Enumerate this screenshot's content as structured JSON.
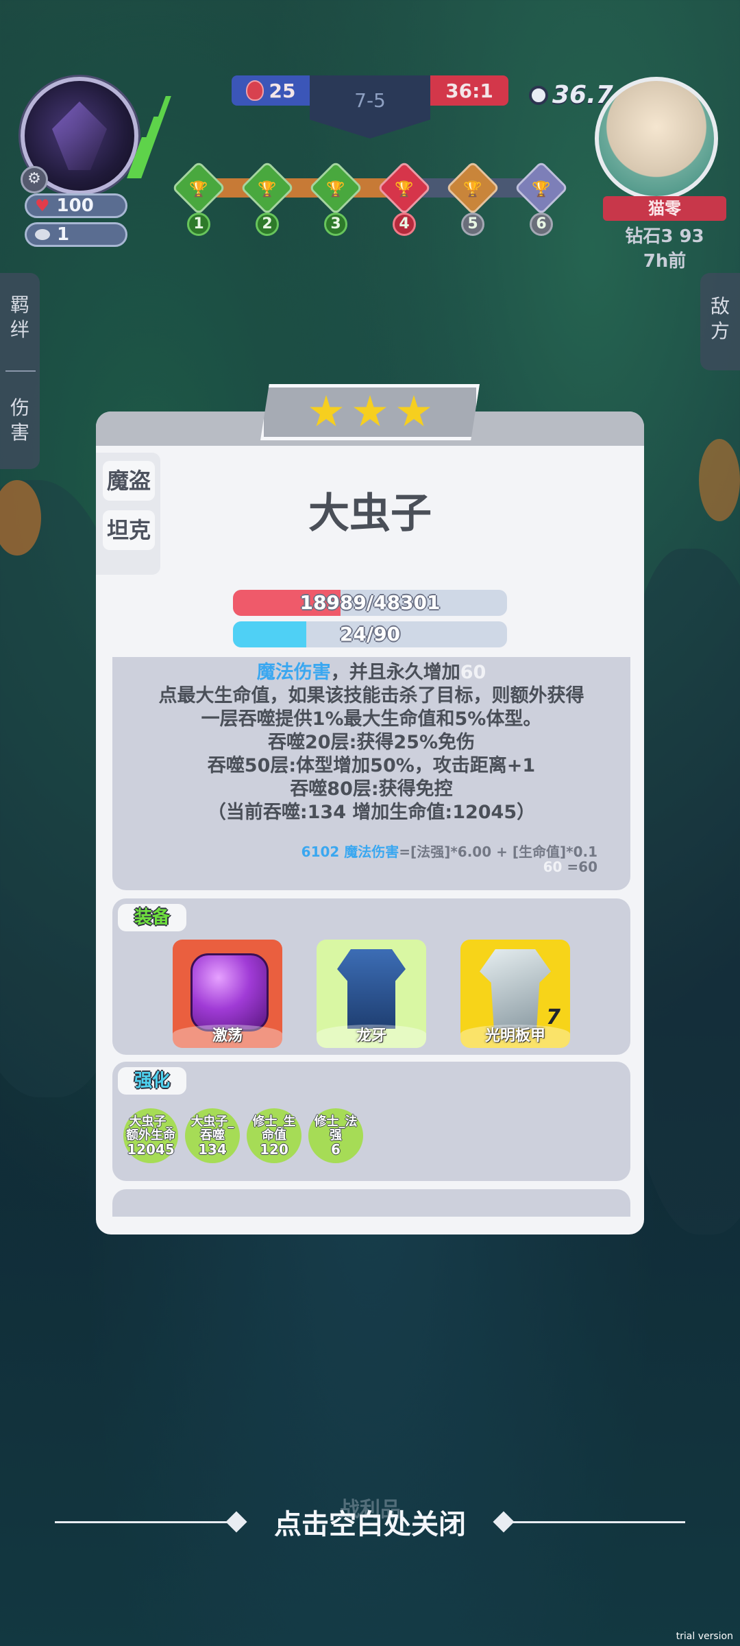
{
  "hud": {
    "player_hp": "100",
    "player_coins": "1",
    "score_blue": "25",
    "round": "7-5",
    "score_red": "36:1",
    "timer": "36.7",
    "stages": [
      "1",
      "2",
      "3",
      "4",
      "5",
      "6"
    ],
    "progress_fraction": 0.6,
    "enemy_name": "猫零",
    "enemy_rank": "钻石3 93",
    "enemy_last_seen": "7h前"
  },
  "side_tabs": {
    "left_top": [
      "羁",
      "绊"
    ],
    "left_bottom": [
      "伤",
      "害"
    ],
    "right": [
      "敌",
      "方"
    ]
  },
  "unit": {
    "stars": 3,
    "traits": [
      "魔盗",
      "坦克"
    ],
    "name": "大虫子",
    "hp_text": "18989/48301",
    "hp_current": 18989,
    "hp_max": 48301,
    "mana_text": "24/90",
    "mana_current": 24,
    "mana_max": 90
  },
  "description": {
    "line1_magic": "魔法伤害",
    "line1_rest": "，并且永久增加",
    "line1_faint": "60",
    "line2": "点最大生命值，如果该技能击杀了目标，则额外获得",
    "line3": "一层吞噬提供1%最大生命值和5%体型。",
    "line4": "吞噬20层:获得25%免伤",
    "line5": "吞噬50层:体型增加50%，攻击距离+1",
    "line6": "吞噬80层:获得免控",
    "line7": "（当前吞噬:134 增加生命值:12045）",
    "formula1_value": "6102 魔法伤害",
    "formula1_rest": "=[法强]*6.00 + [生命值]*0.1",
    "formula2_faint": "60",
    "formula2_rest": " =60"
  },
  "equipment": {
    "label": "装备",
    "items": [
      {
        "name": "激荡",
        "count": ""
      },
      {
        "name": "龙牙",
        "count": ""
      },
      {
        "name": "光明板甲",
        "count": "7"
      }
    ]
  },
  "buffs": {
    "label": "强化",
    "items": [
      {
        "name_a": "大虫子_",
        "name_b": "额外生命",
        "value": "12045"
      },
      {
        "name_a": "大虫子_",
        "name_b": "吞噬",
        "value": "134"
      },
      {
        "name_a": "修士_生",
        "name_b": "命值",
        "value": "120"
      },
      {
        "name_a": "修士_法",
        "name_b": "强",
        "value": "6"
      }
    ]
  },
  "footer": {
    "close_hint": "点击空白处关闭",
    "loot_label": "战利品",
    "watermark": "trial version"
  },
  "colors": {
    "hp_bar": "#ef5a6a",
    "mana_bar": "#4fd0f5",
    "equip_label": "#6fe03e",
    "buff_label": "#4fd2f0",
    "magic_text": "#3aa7f0"
  }
}
